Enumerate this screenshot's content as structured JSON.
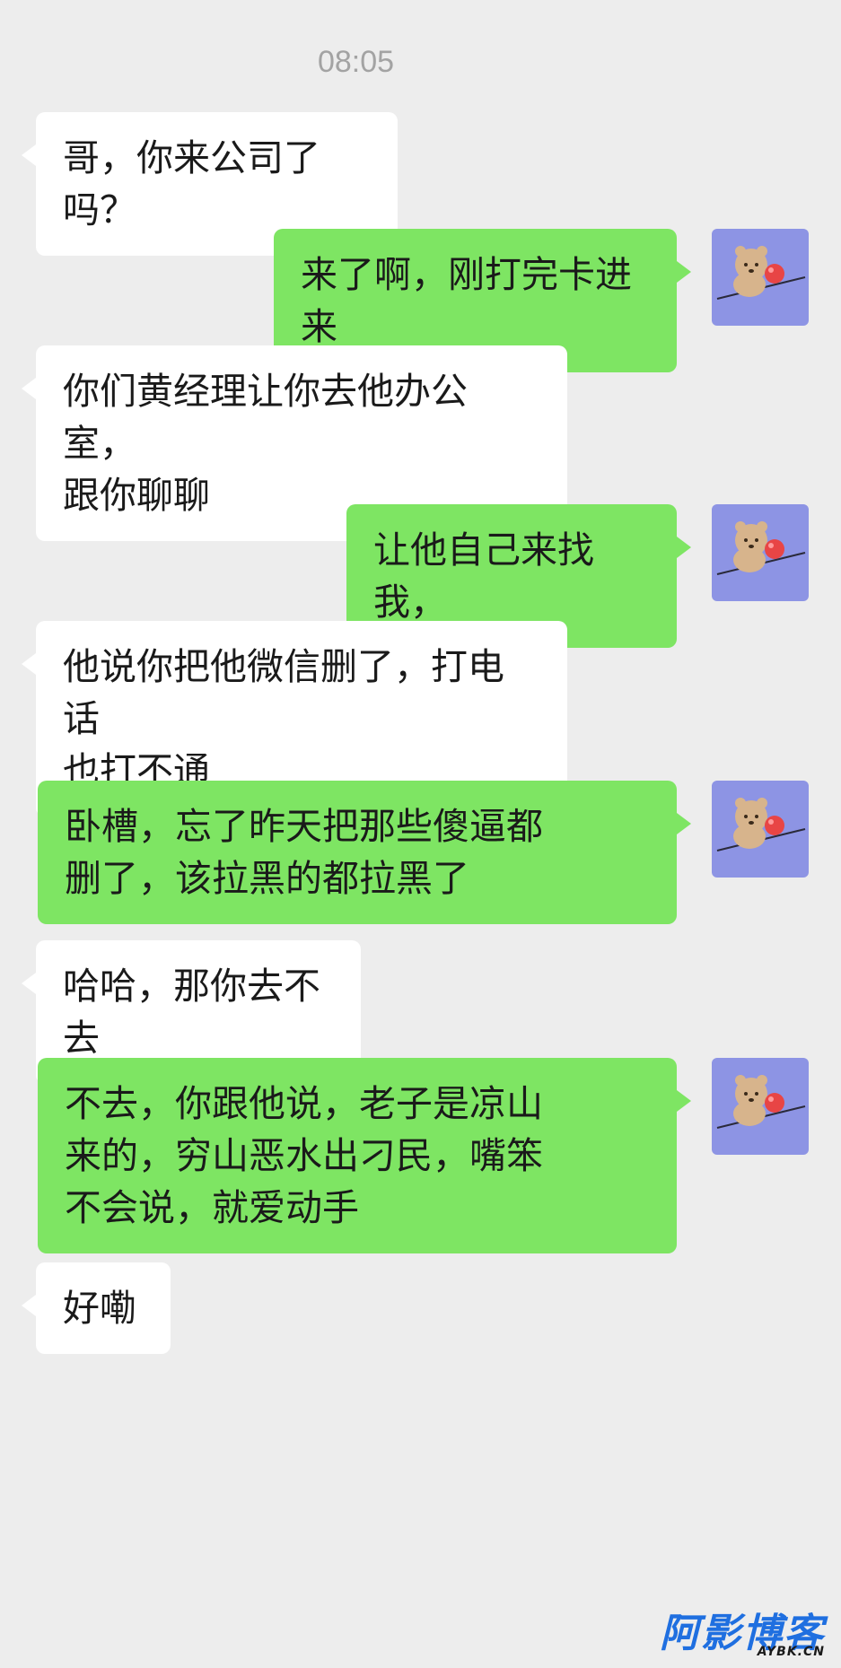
{
  "chat": {
    "time": "08:05",
    "messages": [
      {
        "from": "other",
        "text": "哥，你来公司了吗？"
      },
      {
        "from": "me",
        "text": "来了啊，刚打完卡进来"
      },
      {
        "from": "other",
        "text": "你们黄经理让你去他办公室，\n跟你聊聊"
      },
      {
        "from": "me",
        "text": "让他自己来找我，"
      },
      {
        "from": "other",
        "text": "他说你把他微信删了，打电话\n也打不通"
      },
      {
        "from": "me",
        "text": "卧槽，忘了昨天把那些傻逼都\n删了，该拉黑的都拉黑了"
      },
      {
        "from": "other",
        "text": "哈哈，那你去不去"
      },
      {
        "from": "me",
        "text": "不去，你跟他说，老子是凉山\n来的，穷山恶水出刁民，嘴笨\n不会说，就爱动手"
      },
      {
        "from": "other",
        "text": "好嘞"
      }
    ]
  },
  "avatar": {
    "icon": "bear-avatar-icon",
    "background": "#8d94e4"
  },
  "colors": {
    "incoming": "#ffffff",
    "outgoing": "#7ee563",
    "background": "#ededed"
  },
  "watermark": {
    "main": "阿影博客",
    "sub": "AYBK.CN"
  }
}
